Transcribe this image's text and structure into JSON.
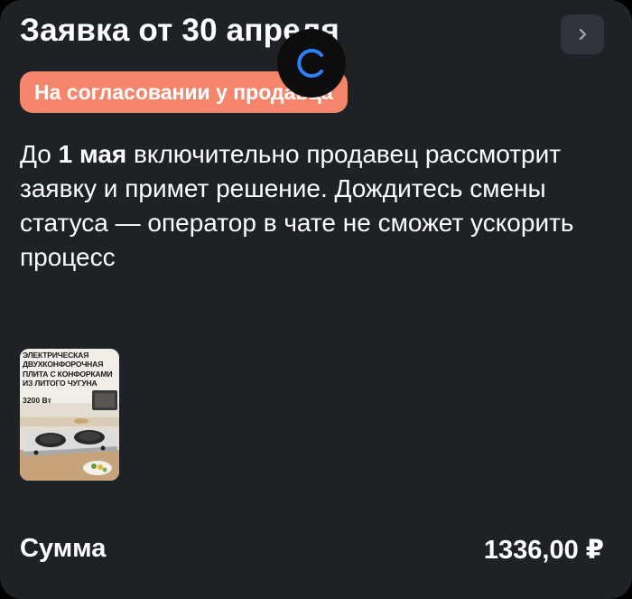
{
  "order": {
    "title": "Заявка от 30 апреля",
    "status_badge": "На согласовании у продавца",
    "status_color": "#f5866b",
    "description": {
      "prefix": "До ",
      "deadline": "1 мая",
      "suffix": " включительно продавец рассмотрит заявку и примет решение. Дождитесь смены статуса — оператор в чате не сможет ускорить процесс"
    }
  },
  "product": {
    "thumb_title": "ЭЛЕКТРИЧЕСКАЯ ДВУХКОНФОРОЧНАЯ ПЛИТА С КОНФОРКАМИ ИЗ ЛИТОГО ЧУГУНА",
    "thumb_power": "3200 Вт"
  },
  "summary": {
    "label": "Сумма",
    "value": "1336,00 ₽"
  },
  "icons": {
    "next": "chevron-right-icon",
    "loading": "loading-spinner-icon"
  },
  "colors": {
    "card_bg": "#1e2126",
    "spinner_accent": "#2f80ff"
  }
}
